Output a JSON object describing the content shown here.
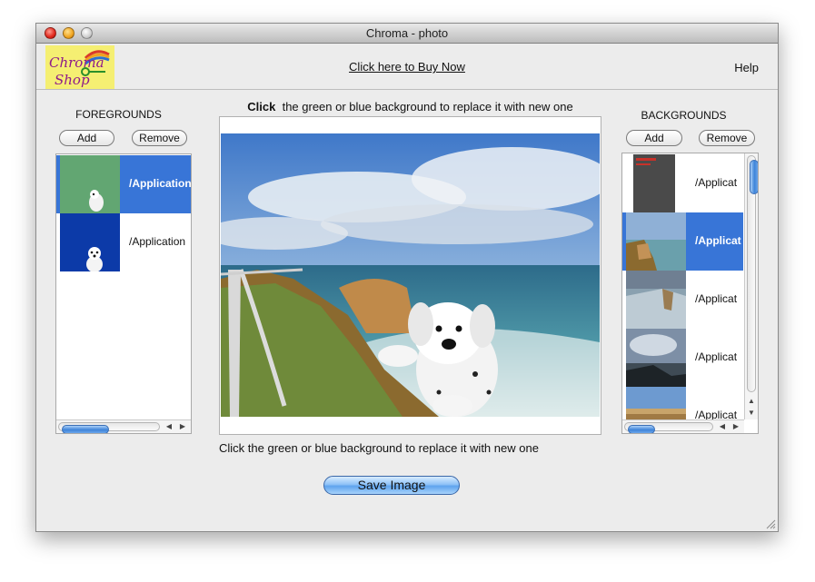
{
  "window": {
    "title": "Chroma - photo"
  },
  "toolbar": {
    "logo_text_line1": "Chroma",
    "logo_text_line2": "Shop",
    "buy_link": "Click here to Buy Now",
    "help": "Help"
  },
  "foregrounds": {
    "title": "FOREGROUNDS",
    "add_label": "Add",
    "remove_label": "Remove",
    "items": [
      {
        "label": "/Application",
        "selected": true,
        "thumb": "green background with white puppy"
      },
      {
        "label": "/Application",
        "selected": false,
        "thumb": "blue background with white puppy"
      }
    ]
  },
  "preview": {
    "instruction_bold": "Click",
    "instruction_rest": "the green or blue background to replace it with new one",
    "instruction_bottom": "Click the green or blue background to replace it with new one"
  },
  "backgrounds": {
    "title": "BACKGROUNDS",
    "add_label": "Add",
    "remove_label": "Remove",
    "items": [
      {
        "label": "/Applicat",
        "selected": false
      },
      {
        "label": "/Applicat",
        "selected": true
      },
      {
        "label": "/Applicat",
        "selected": false
      },
      {
        "label": "/Applicat",
        "selected": false
      },
      {
        "label": "/Applicat",
        "selected": false
      }
    ]
  },
  "actions": {
    "save_label": "Save Image"
  },
  "icons": {
    "close": "close-icon",
    "minimize": "minimize-icon",
    "zoom": "zoom-icon",
    "scroll_left": "arrow-left-icon",
    "scroll_right": "arrow-right-icon",
    "scroll_up": "arrow-up-icon",
    "scroll_down": "arrow-down-icon",
    "resize": "resize-grip-icon"
  },
  "colors": {
    "selection": "#3875d7",
    "logo_bg": "#f5ef72",
    "save_button": "#5ea3ee"
  }
}
